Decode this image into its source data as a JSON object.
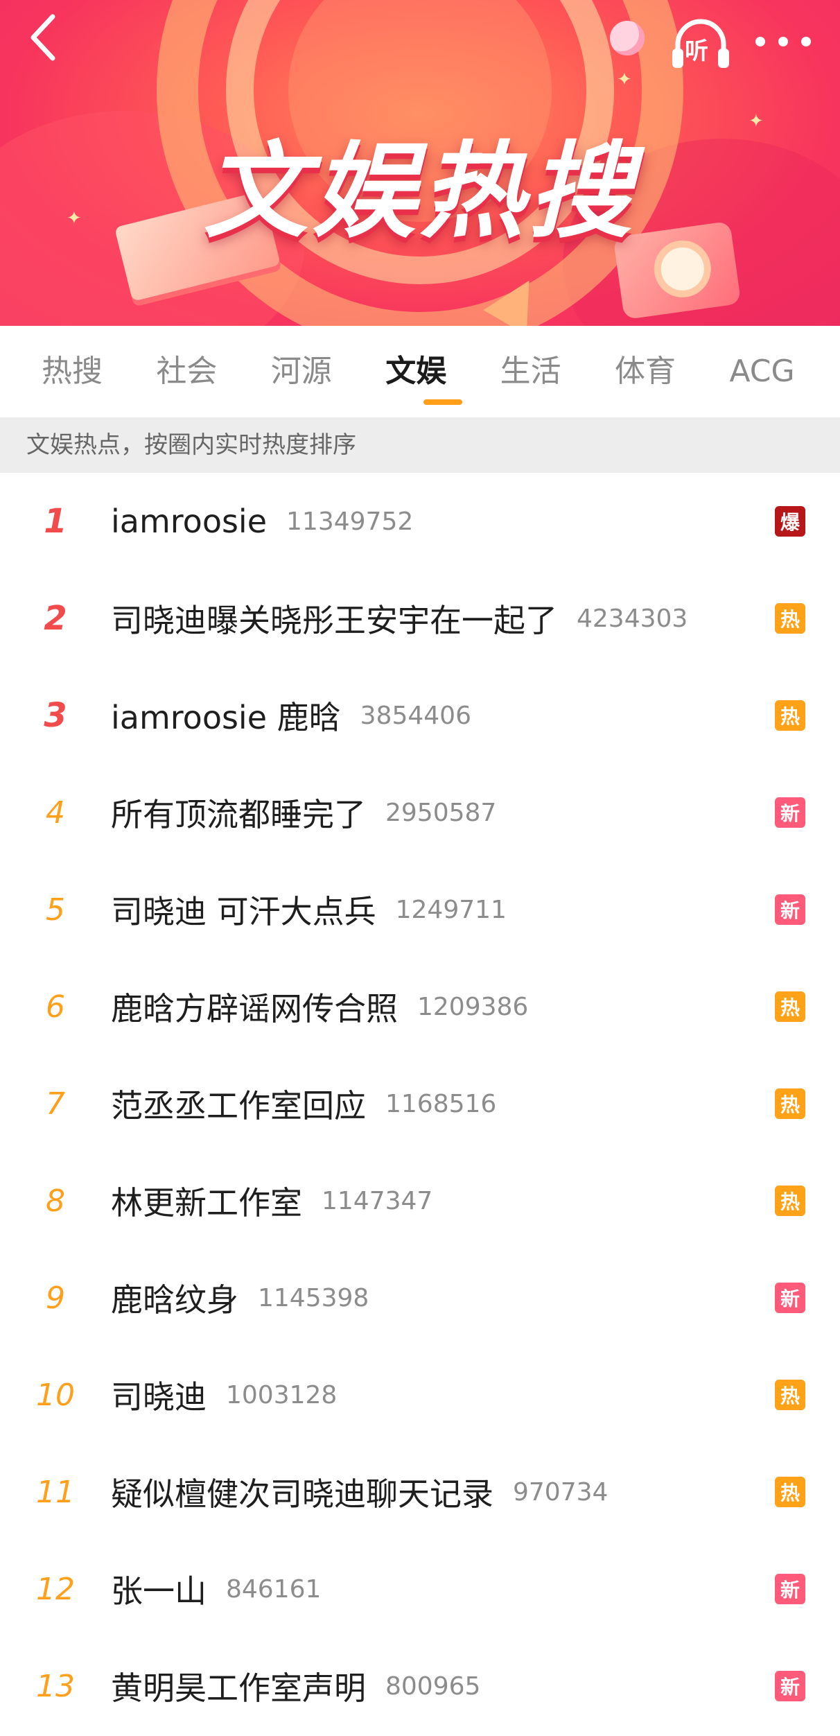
{
  "header": {
    "title": "文娱热搜",
    "listen_label": "听"
  },
  "tabs": [
    {
      "label": "热搜"
    },
    {
      "label": "社会"
    },
    {
      "label": "河源"
    },
    {
      "label": "文娱",
      "active": true
    },
    {
      "label": "生活"
    },
    {
      "label": "体育"
    },
    {
      "label": "ACG"
    }
  ],
  "subheader": "文娱热点，按圈内实时热度排序",
  "list": [
    {
      "rank": "1",
      "title": "iamroosie",
      "count": "11349752",
      "badge": "爆",
      "badge_type": "bao"
    },
    {
      "rank": "2",
      "title": "司晓迪曝关晓彤王安宇在一起了",
      "count": "4234303",
      "badge": "热",
      "badge_type": "re"
    },
    {
      "rank": "3",
      "title": "iamroosie 鹿晗",
      "count": "3854406",
      "badge": "热",
      "badge_type": "re"
    },
    {
      "rank": "4",
      "title": "所有顶流都睡完了",
      "count": "2950587",
      "badge": "新",
      "badge_type": "xin"
    },
    {
      "rank": "5",
      "title": "司晓迪 可汗大点兵",
      "count": "1249711",
      "badge": "新",
      "badge_type": "xin"
    },
    {
      "rank": "6",
      "title": "鹿晗方辟谣网传合照",
      "count": "1209386",
      "badge": "热",
      "badge_type": "re"
    },
    {
      "rank": "7",
      "title": "范丞丞工作室回应",
      "count": "1168516",
      "badge": "热",
      "badge_type": "re"
    },
    {
      "rank": "8",
      "title": "林更新工作室",
      "count": "1147347",
      "badge": "热",
      "badge_type": "re"
    },
    {
      "rank": "9",
      "title": "鹿晗纹身",
      "count": "1145398",
      "badge": "新",
      "badge_type": "xin"
    },
    {
      "rank": "10",
      "title": "司晓迪",
      "count": "1003128",
      "badge": "热",
      "badge_type": "re"
    },
    {
      "rank": "11",
      "title": "疑似檀健次司晓迪聊天记录",
      "count": "970734",
      "badge": "热",
      "badge_type": "re"
    },
    {
      "rank": "12",
      "title": "张一山",
      "count": "846161",
      "badge": "新",
      "badge_type": "xin"
    },
    {
      "rank": "13",
      "title": "黄明昊工作室声明",
      "count": "800965",
      "badge": "新",
      "badge_type": "xin"
    }
  ],
  "colors": {
    "accent": "#ff9f1a",
    "top_rank": "#f14b4b",
    "badge_bao": "#b8171a",
    "badge_re": "#ffa218",
    "badge_xin": "#ff5a7a"
  },
  "icons": [
    "back-arrow-icon",
    "headphones-icon",
    "more-dots-icon"
  ]
}
